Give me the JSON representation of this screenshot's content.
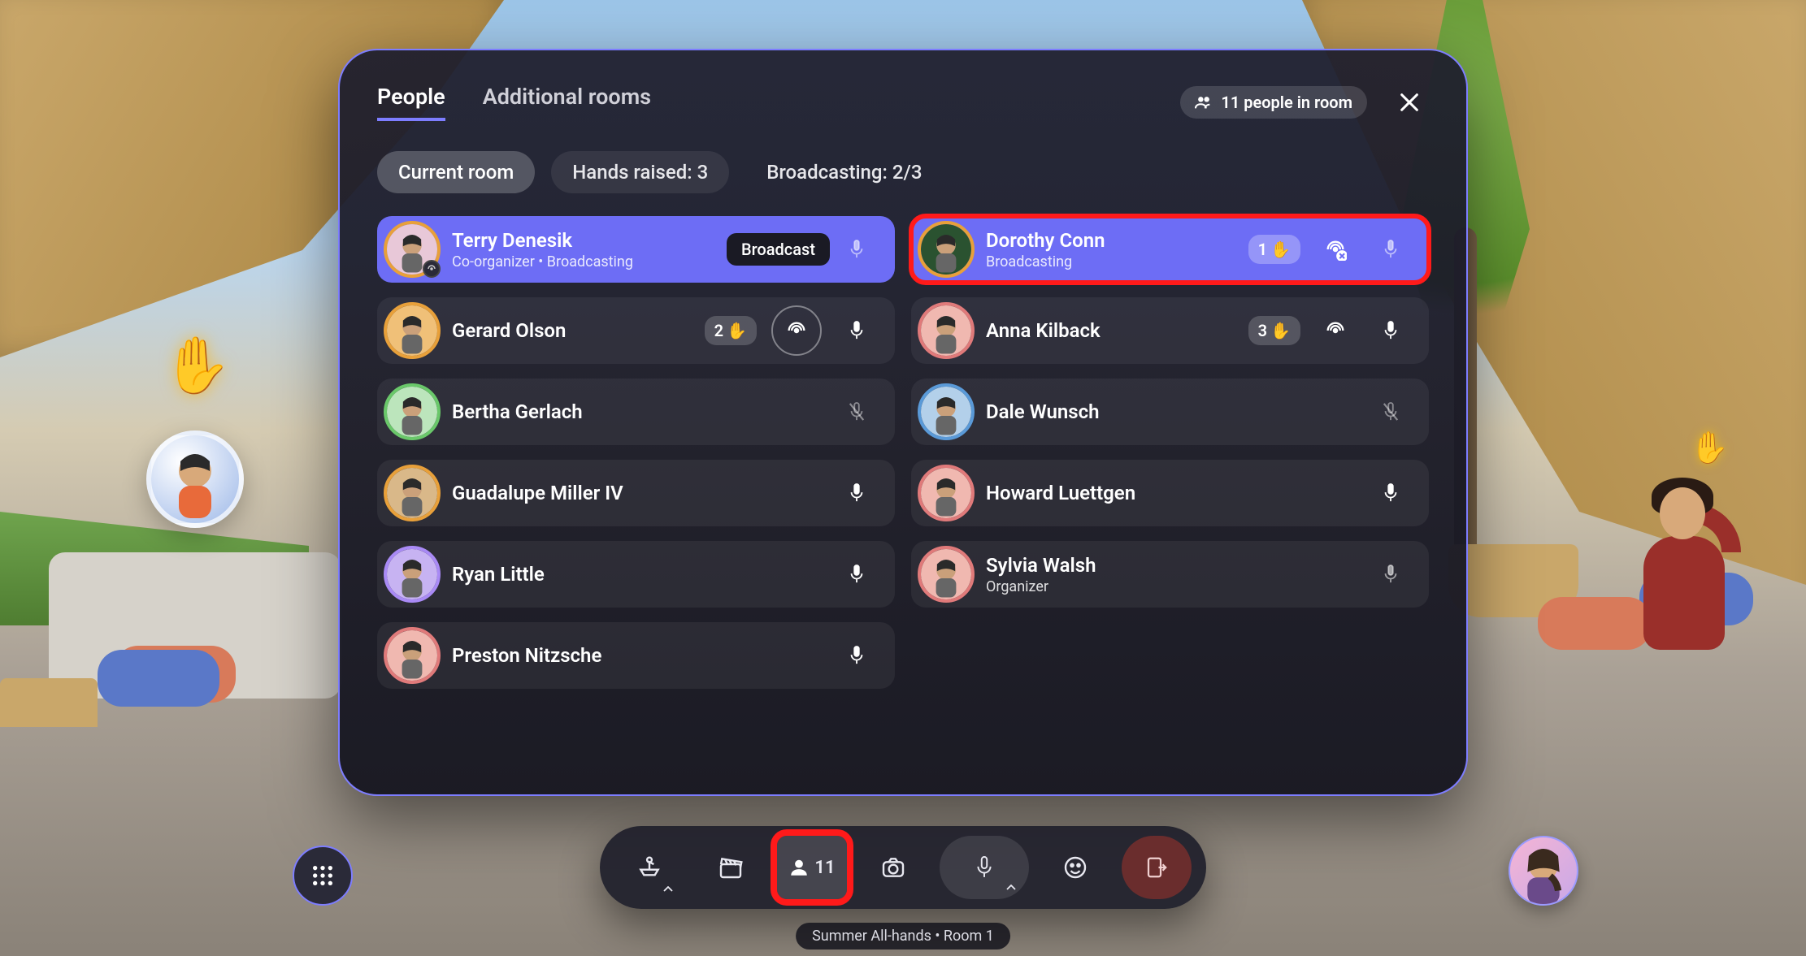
{
  "panel": {
    "tabs": {
      "people": "People",
      "rooms": "Additional rooms"
    },
    "room_count_label": "11 people in room",
    "filters": {
      "current": "Current room",
      "hands": "Hands raised: 3",
      "broadcasting": "Broadcasting: 2/3"
    },
    "tooltip_broadcast": "Broadcast"
  },
  "people": {
    "left": [
      {
        "name": "Terry Denesik",
        "sub": "Co-organizer • Broadcasting",
        "highlight": true,
        "ring": "#e8a03a",
        "bg": "#e8c8d8",
        "hand": null,
        "broadcast_badge": true,
        "mic": "faded",
        "showTooltip": true
      },
      {
        "name": "Gerard Olson",
        "sub": "",
        "ring": "#e8a03a",
        "bg": "#f0c078",
        "hand": "2",
        "mic": "on",
        "broadcast_button_outline": true
      },
      {
        "name": "Bertha Gerlach",
        "sub": "",
        "ring": "#6ac86a",
        "bg": "#bce5bc",
        "mic": "muted"
      },
      {
        "name": "Guadalupe Miller IV",
        "sub": "",
        "ring": "#e8a03a",
        "bg": "#d9b889",
        "mic": "on"
      },
      {
        "name": "Ryan Little",
        "sub": "",
        "ring": "#a98af5",
        "bg": "#c7b3f2",
        "mic": "on"
      },
      {
        "name": "Preston Nitzsche",
        "sub": "",
        "ring": "#e07a7a",
        "bg": "#f0b8b0",
        "mic": "on"
      }
    ],
    "right": [
      {
        "name": "Dorothy Conn",
        "sub": "Broadcasting",
        "highlight": true,
        "redbox": true,
        "ring": "#e8a03a",
        "bg": "#2a5230",
        "hand": "1",
        "broadcast_stop": true,
        "mic": "faded"
      },
      {
        "name": "Anna Kilback",
        "sub": "",
        "ring": "#e07a7a",
        "bg": "#f0b8b0",
        "hand": "3",
        "broadcast_plain": true,
        "mic": "on"
      },
      {
        "name": "Dale Wunsch",
        "sub": "",
        "ring": "#5a9ad8",
        "bg": "#b3d0ea",
        "mic": "muted"
      },
      {
        "name": "Howard Luettgen",
        "sub": "",
        "ring": "#e07a7a",
        "bg": "#f0b8b0",
        "mic": "on"
      },
      {
        "name": "Sylvia Walsh",
        "sub": "Organizer",
        "ring": "#e07a7a",
        "bg": "#f0b8b0",
        "mic": "faded"
      }
    ]
  },
  "toolbar": {
    "people_count": "11"
  },
  "footer": {
    "room": "Summer All-hands • Room 1"
  },
  "icons": {
    "mic_on": "mic-icon",
    "mic_muted": "mic-muted-icon",
    "broadcast": "broadcast-icon",
    "close": "close-icon",
    "people": "people-icon",
    "grid": "grid-icon",
    "boat": "spaces-icon",
    "clapper": "clapper-icon",
    "camera": "camera-icon",
    "emoji": "emoji-icon",
    "leave": "leave-icon"
  }
}
